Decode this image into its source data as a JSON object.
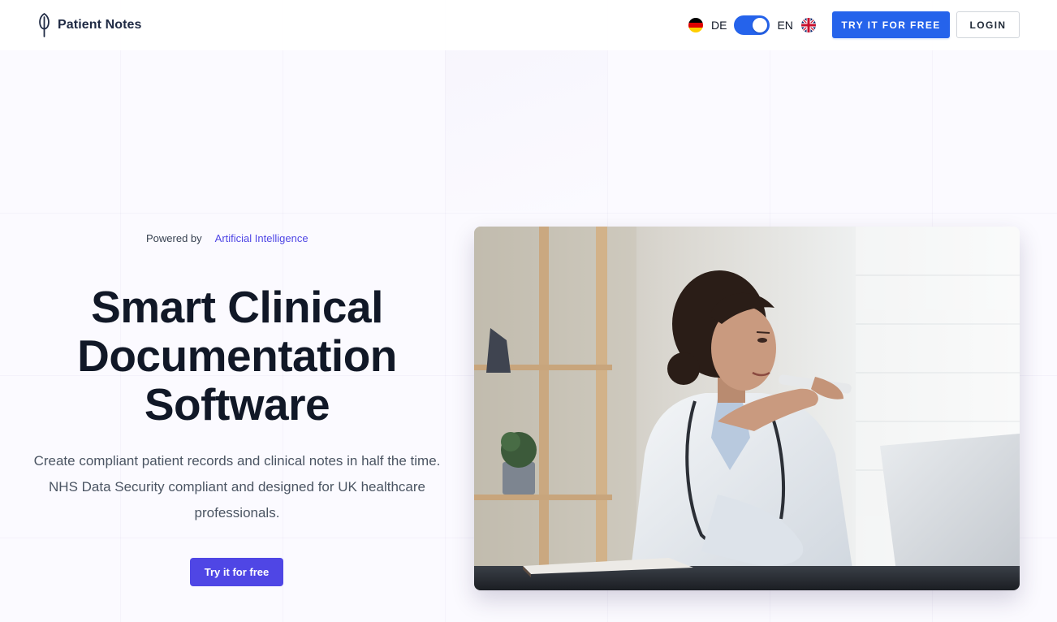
{
  "brand": {
    "name": "Patient Notes",
    "colors": {
      "primary": "#2563eb",
      "accent": "#4f46e5",
      "text": "#111827"
    }
  },
  "header": {
    "language": {
      "left_code": "DE",
      "right_code": "EN",
      "selected": "EN"
    },
    "cta_label": "TRY IT FOR FREE",
    "login_label": "LOGIN"
  },
  "hero": {
    "powered_label": "Powered by",
    "powered_highlight": "Artificial Intelligence",
    "title_lines": [
      "Smart Clinical",
      "Documentation",
      "Software"
    ],
    "description": "Create compliant patient records and clinical notes in half the time. NHS Data Security compliant and designed for UK healthcare professionals.",
    "button_label": "Try it for free"
  },
  "icons": {
    "logo": "quill-feather-icon",
    "flag_de": "flag-germany-icon",
    "flag_en": "flag-uk-icon"
  }
}
